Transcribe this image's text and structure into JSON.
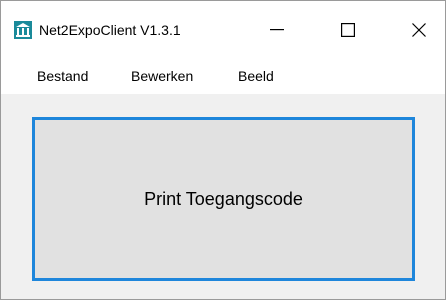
{
  "window": {
    "title": "Net2ExpoClient V1.3.1",
    "app_icon": "bank-building-icon"
  },
  "controls": {
    "minimize_icon": "minimize-icon",
    "maximize_icon": "maximize-icon",
    "close_icon": "close-icon"
  },
  "menu": {
    "items": [
      {
        "label": "Bestand"
      },
      {
        "label": "Bewerken"
      },
      {
        "label": "Beeld"
      }
    ]
  },
  "main": {
    "print_button_label": "Print Toegangscode"
  },
  "colors": {
    "accent_border": "#1e86db",
    "button_face": "#e1e1e1",
    "window_bg": "#f0f0f0",
    "icon_teal": "#1a8a9a"
  }
}
